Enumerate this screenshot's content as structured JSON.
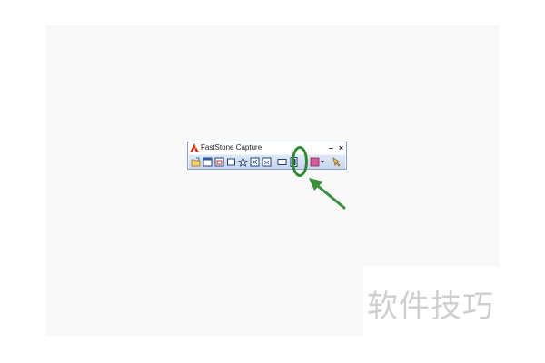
{
  "window": {
    "title": "FastStone Capture",
    "minimize_glyph": "–",
    "close_glyph": "×"
  },
  "toolbar": {
    "tools": [
      {
        "name": "open-file-icon"
      },
      {
        "name": "capture-active-window-icon"
      },
      {
        "name": "capture-window-object-icon"
      },
      {
        "name": "capture-rectangular-region-icon"
      },
      {
        "name": "capture-freehand-region-icon"
      },
      {
        "name": "capture-full-screen-icon"
      },
      {
        "name": "capture-scrolling-window-icon"
      },
      {
        "name": "capture-fixed-region-icon"
      },
      {
        "name": "screen-recorder-icon"
      },
      {
        "name": "output-destination-icon"
      },
      {
        "name": "settings-icon"
      }
    ]
  },
  "annotation": {
    "ring_color": "#2f8b2f",
    "arrow_color": "#3a8f3a"
  },
  "watermark": {
    "text": "软件技巧"
  }
}
